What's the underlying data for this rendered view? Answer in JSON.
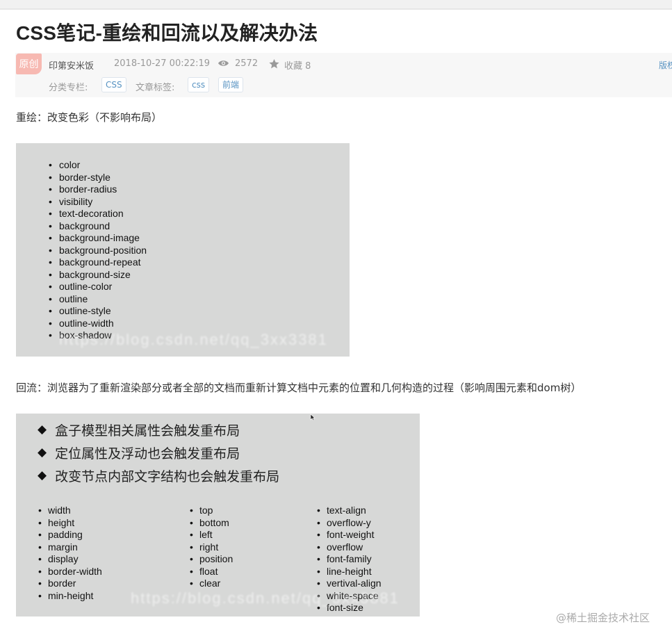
{
  "article": {
    "title": "CSS笔记-重绘和回流以及解决办法",
    "badge": "原创",
    "author": "印第安米饭",
    "date": "2018-10-27 00:22:19",
    "views": "2572",
    "favorites": "收藏 8",
    "copyright": "版权",
    "category_label": "分类专栏:",
    "category": "CSS",
    "tags_label": "文章标签:",
    "tags": [
      "css",
      "前端"
    ],
    "icons": {
      "views": "eye-icon",
      "favorites": "star-icon"
    }
  },
  "content": {
    "repaint_text": "重绘：改变色彩（不影响布局）",
    "repaint_items": [
      "color",
      "border-style",
      "border-radius",
      "visibility",
      "text-decoration",
      "background",
      "background-image",
      "background-position",
      "background-repeat",
      "background-size",
      "outline-color",
      "outline",
      "outline-style",
      "outline-width",
      "box-shadow"
    ],
    "reflow_text": "回流：浏览器为了重新渲染部分或者全部的文档而重新计算文档中元素的位置和几何构造的过程（影响周围元素和dom树）",
    "reflow_points": [
      "盒子模型相关属性会触发重布局",
      "定位属性及浮动也会触发重布局",
      "改变节点内部文字结构也会触发重布局"
    ],
    "reflow_col1": [
      "width",
      "height",
      "padding",
      "margin",
      "display",
      "border-width",
      "border",
      "min-height"
    ],
    "reflow_col2": [
      "top",
      "bottom",
      "left",
      "right",
      "position",
      "float",
      "clear"
    ],
    "reflow_col3": [
      "text-align",
      "overflow-y",
      "font-weight",
      "overflow",
      "font-family",
      "line-height",
      "vertival-align",
      "white-space",
      "font-size"
    ],
    "image_watermark_1": "https://blog.csdn.net/qq_3xx3381",
    "image_watermark_2": "https://blog.csdn.net/qq_3xx3881"
  },
  "footer": {
    "watermark": "@稀土掘金技术社区"
  },
  "colors": {
    "badge": "#f7b9b2",
    "link": "#5893c2",
    "image_bg": "#d7d8d7"
  }
}
